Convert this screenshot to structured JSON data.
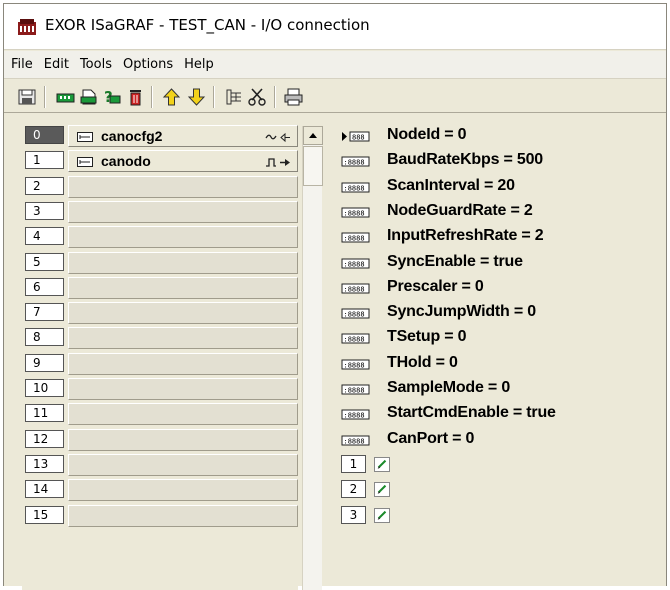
{
  "window": {
    "title": "EXOR ISaGRAF - TEST_CAN - I/O connection"
  },
  "menu": {
    "items": [
      "File",
      "Edit",
      "Tools",
      "Options",
      "Help"
    ]
  },
  "toolbar": {
    "buttons": [
      "save-icon",
      "board-connect-icon",
      "board-properties-icon",
      "board-help-icon",
      "delete-icon",
      "move-up-icon",
      "move-down-icon",
      "tree-view-icon",
      "cut-icon",
      "print-icon"
    ]
  },
  "slots": [
    {
      "num": "0",
      "name": "canocfg2",
      "direction": "in-out",
      "selected": true
    },
    {
      "num": "1",
      "name": "canodo",
      "direction": "output",
      "selected": false
    },
    {
      "num": "2",
      "name": ""
    },
    {
      "num": "3",
      "name": ""
    },
    {
      "num": "4",
      "name": ""
    },
    {
      "num": "5",
      "name": ""
    },
    {
      "num": "6",
      "name": ""
    },
    {
      "num": "7",
      "name": ""
    },
    {
      "num": "8",
      "name": ""
    },
    {
      "num": "9",
      "name": ""
    },
    {
      "num": "10",
      "name": ""
    },
    {
      "num": "11",
      "name": ""
    },
    {
      "num": "12",
      "name": ""
    },
    {
      "num": "13",
      "name": ""
    },
    {
      "num": "14",
      "name": ""
    },
    {
      "num": "15",
      "name": ""
    }
  ],
  "params": [
    "NodeId = 0",
    "BaudRateKbps = 500",
    "ScanInterval = 20",
    "NodeGuardRate = 2",
    "InputRefreshRate = 2",
    "SyncEnable = true",
    "Prescaler = 0",
    "SyncJumpWidth = 0",
    "TSetup = 0",
    "THold = 0",
    "SampleMode = 0",
    "StartCmdEnable = true",
    "CanPort = 0"
  ],
  "channels": [
    "1",
    "2",
    "3"
  ]
}
